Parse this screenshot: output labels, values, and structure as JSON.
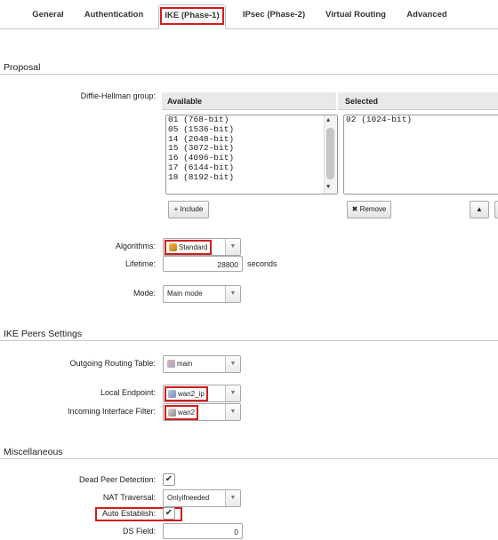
{
  "tabs": [
    {
      "label": "General"
    },
    {
      "label": "Authentication"
    },
    {
      "label": "IKE (Phase-1)"
    },
    {
      "label": "IPsec (Phase-2)"
    },
    {
      "label": "Virtual Routing"
    },
    {
      "label": "Advanced"
    }
  ],
  "proposal": {
    "title": "Proposal",
    "dh_label": "Diffie-Hellman group:",
    "available_header": "Available",
    "selected_header": "Selected",
    "available_items": [
      "01 (768-bit)",
      "05 (1536-bit)",
      "14 (2048-bit)",
      "15 (3072-bit)",
      "16 (4096-bit)",
      "17 (6144-bit)",
      "18 (8192-bit)"
    ],
    "selected_items": [
      "02 (1024-bit)"
    ],
    "include_label": "+ Include",
    "remove_label": "✖ Remove",
    "algorithms_label": "Algorithms:",
    "algorithms_value": "Standard",
    "lifetime_label": "Lifetime:",
    "lifetime_value": "28800",
    "lifetime_unit": "seconds",
    "mode_label": "Mode:",
    "mode_value": "Main mode"
  },
  "peers": {
    "title": "IKE Peers Settings",
    "routing_label": "Outgoing Routing Table:",
    "routing_value": "main",
    "endpoint_label": "Local Endpoint:",
    "endpoint_value": "wan2_ip",
    "filter_label": "Incoming Interface Filter:",
    "filter_value": "wan2"
  },
  "misc": {
    "title": "Miscellaneous",
    "dpd_label": "Dead Peer Detection:",
    "nat_label": "NAT Traversal:",
    "nat_value": "Onlyifneeded",
    "auto_label": "Auto Establish:",
    "ds_label": "DS Field:",
    "ds_value": "0"
  },
  "colors": {
    "highlight": "#d21c1c"
  }
}
